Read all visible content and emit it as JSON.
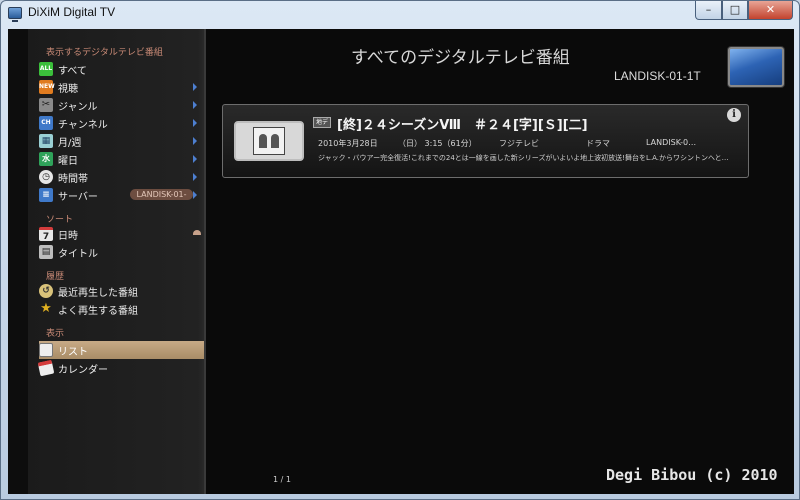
{
  "window": {
    "title": "DiXiM Digital TV",
    "minimize": "–",
    "maximize": "□",
    "close": "✕"
  },
  "sidebar": {
    "section_show": "表示するデジタルテレビ番組",
    "section_sort": "ソート",
    "section_history": "履歴",
    "section_display": "表示",
    "items": [
      {
        "label": "すべて",
        "icon_text": "ALL",
        "color": "#3bbf3b"
      },
      {
        "label": "視聴",
        "icon_text": "NEW",
        "color": "#e07b1f"
      },
      {
        "label": "ジャンル",
        "icon_text": "",
        "color": "#cfcfcf"
      },
      {
        "label": "チャンネル",
        "icon_text": "CH",
        "color": "#3f79c9"
      },
      {
        "label": "月/週",
        "icon_text": "",
        "color": "#9ad0d4"
      },
      {
        "label": "曜日",
        "icon_text": "水",
        "color": "#2fa35a"
      },
      {
        "label": "時間帯",
        "icon_text": "",
        "color": "#e6e6e6"
      },
      {
        "label": "サーバー",
        "icon_text": "",
        "color": "#3f79c9",
        "badge": "LANDISK-01-"
      }
    ],
    "sort_items": [
      {
        "label": "日時",
        "icon_text": "7",
        "color": "#e6e6e6"
      },
      {
        "label": "タイトル",
        "icon_text": "",
        "color": "#bdbdbd"
      }
    ],
    "history_items": [
      {
        "label": "最近再生した番組",
        "icon_text": "",
        "color": "#d9c27a"
      },
      {
        "label": "よく再生する番組",
        "icon_text": "★",
        "color": "#e0b020"
      }
    ],
    "display_items": [
      {
        "label": "リスト",
        "icon_text": "",
        "color": "#eeeeee"
      },
      {
        "label": "カレンダー",
        "icon_text": "",
        "color": "#d43c3c"
      }
    ]
  },
  "main": {
    "title": "すべてのデジタルテレビ番組",
    "device_name": "LANDISK-01-1T",
    "program": {
      "badge": "地デ",
      "title": "[終]２４シーズンⅧ　＃２４[字][Ｓ][二]",
      "date": "2010年3月28日",
      "weekday_time": "（日）  3:15（61分）",
      "channel": "フジテレビ",
      "genre": "ドラマ",
      "server": "LANDISK-0…",
      "description": "ジャック・バウアー完全復活!これまでの24とは一線を画した新シリーズがいよいよ地上波初放送!舞台をL.A.からワシントンへと…",
      "info_icon": "i"
    },
    "pager": "1 / 1"
  },
  "watermark": "Degi Bibou (c) 2010"
}
